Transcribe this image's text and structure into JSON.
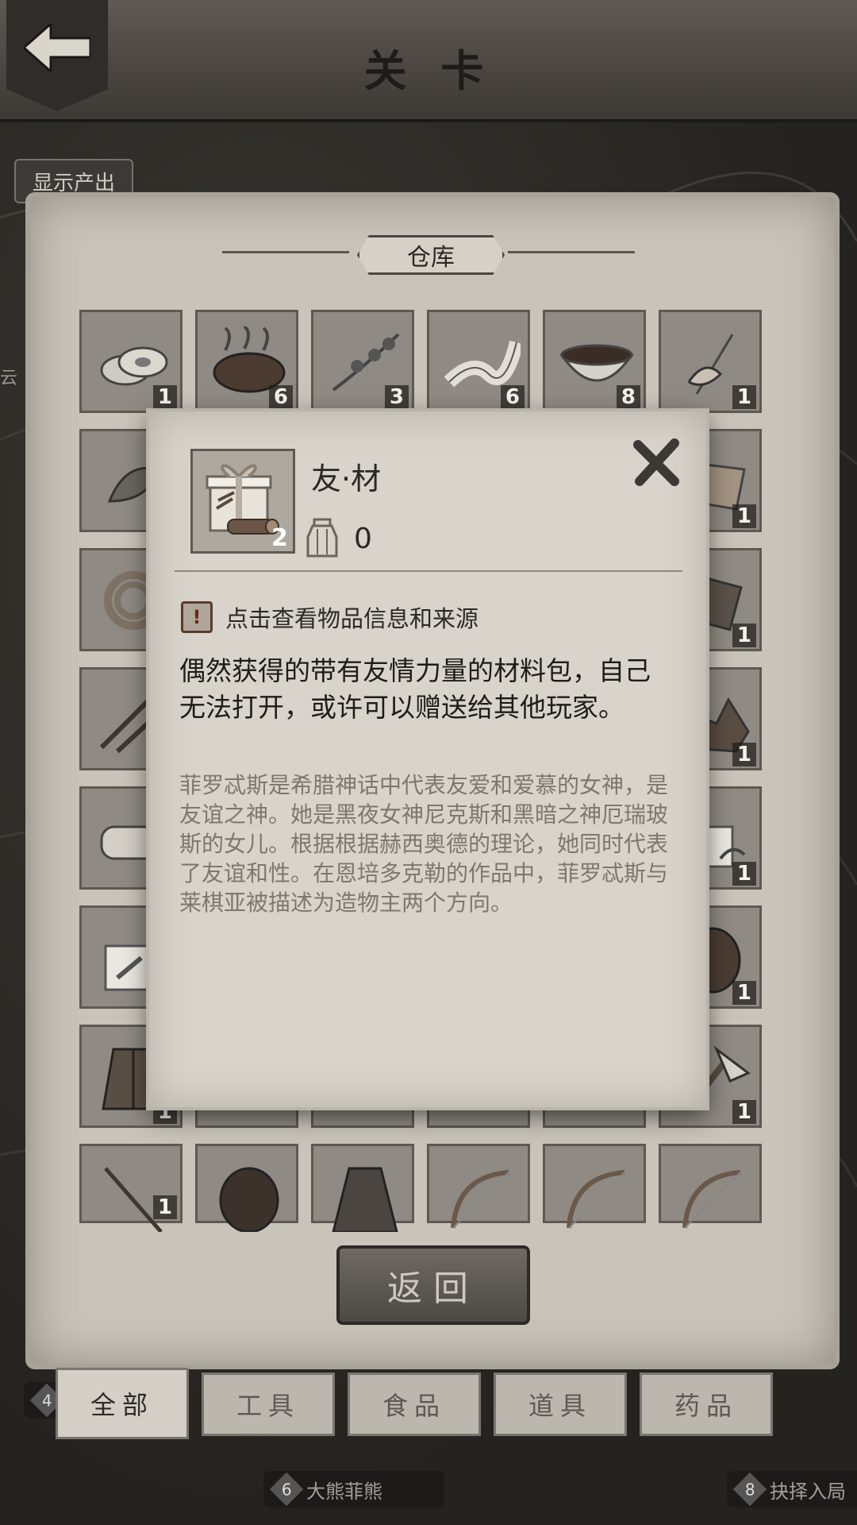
{
  "header": {
    "title": "关 卡"
  },
  "map": {
    "show_output_label": "显示产出",
    "side_label": "云",
    "stages": [
      {
        "num": "4",
        "label": ""
      },
      {
        "num": "6",
        "label": "大熊菲熊"
      },
      {
        "num": "8",
        "label": "抉择入局"
      }
    ]
  },
  "warehouse": {
    "title": "仓库",
    "rows": [
      [
        {
          "icon": "coins-icon",
          "count": "1"
        },
        {
          "icon": "roast-meat-icon",
          "count": "6"
        },
        {
          "icon": "herb-branch-icon",
          "count": "3"
        },
        {
          "icon": "bandage-icon",
          "count": "6"
        },
        {
          "icon": "bowl-icon",
          "count": "8"
        },
        {
          "icon": "flower-icon",
          "count": "1"
        }
      ],
      [
        {
          "icon": "leaves-icon",
          "count": ""
        },
        null,
        null,
        null,
        null,
        {
          "icon": "cloth-icon",
          "count": "1"
        }
      ],
      [
        {
          "icon": "rope-icon",
          "count": ""
        },
        null,
        null,
        null,
        null,
        {
          "icon": "plank-icon",
          "count": "1"
        }
      ],
      [
        {
          "icon": "arrows-icon",
          "count": ""
        },
        null,
        null,
        null,
        null,
        {
          "icon": "stones-icon",
          "count": "1"
        }
      ],
      [
        {
          "icon": "bread-icon",
          "count": ""
        },
        null,
        null,
        null,
        null,
        {
          "icon": "gift-herb-icon",
          "count": "1"
        }
      ],
      [
        {
          "icon": "gift-hammer-icon",
          "count": ""
        },
        null,
        null,
        null,
        null,
        {
          "icon": "shield-icon",
          "count": "1"
        }
      ],
      [
        {
          "icon": "vest-icon",
          "count": "1"
        },
        null,
        null,
        null,
        null,
        {
          "icon": "axe-icon",
          "count": "1"
        }
      ],
      [
        {
          "icon": "spear-icon",
          "count": "1"
        },
        {
          "icon": "wood-shield-icon",
          "count": ""
        },
        {
          "icon": "coat-icon",
          "count": ""
        },
        {
          "icon": "bow-icon",
          "count": ""
        },
        {
          "icon": "bow-icon",
          "count": ""
        },
        {
          "icon": "bow-icon",
          "count": ""
        }
      ]
    ],
    "return_label": "返回"
  },
  "tabs": [
    {
      "label": "全部",
      "active": true
    },
    {
      "label": "工具",
      "active": false
    },
    {
      "label": "食品",
      "active": false
    },
    {
      "label": "道具",
      "active": false
    },
    {
      "label": "药品",
      "active": false
    }
  ],
  "dialog": {
    "item_name": "友·材",
    "item_icon": "gift-wood-icon",
    "item_count": "2",
    "owned_icon": "jar-icon",
    "owned_count": "0",
    "hint_icon": "exclamation-icon",
    "hint_text": "点击查看物品信息和来源",
    "description": "偶然获得的带有友情力量的材料包，自己无法打开，或许可以赠送给其他玩家。",
    "lore": "菲罗忒斯是希腊神话中代表友爱和爱慕的女神，是友谊之神。她是黑夜女神尼克斯和黑暗之神厄瑞玻斯的女儿。根据根据赫西奥德的理论，她同时代表了友谊和性。在恩培多克勒的作品中，菲罗忒斯与莱棋亚被描述为造物主两个方向。",
    "close_icon": "close-icon"
  }
}
